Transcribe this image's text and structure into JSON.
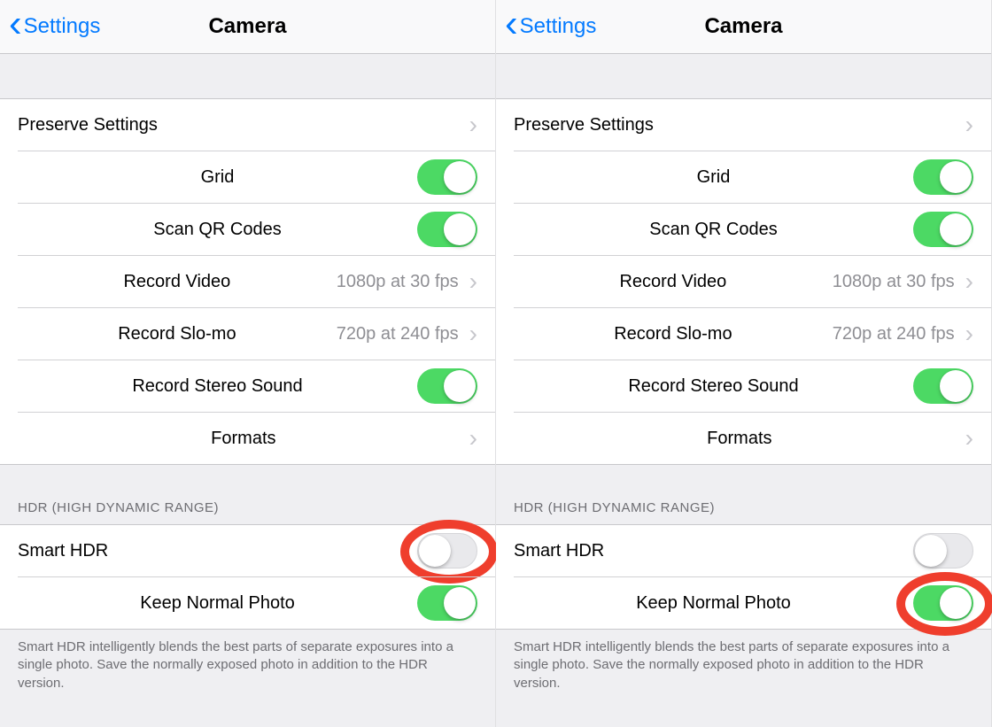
{
  "colors": {
    "tint": "#037aff",
    "toggle_on": "#4cd964",
    "annotation": "#ef3e2d"
  },
  "screens": [
    {
      "nav": {
        "back": "Settings",
        "title": "Camera"
      },
      "group1": [
        {
          "kind": "nav",
          "label": "Preserve Settings"
        },
        {
          "kind": "toggle",
          "label": "Grid",
          "on": true
        },
        {
          "kind": "toggle",
          "label": "Scan QR Codes",
          "on": true
        },
        {
          "kind": "nav",
          "label": "Record Video",
          "value": "1080p at 30 fps"
        },
        {
          "kind": "nav",
          "label": "Record Slo-mo",
          "value": "720p at 240 fps"
        },
        {
          "kind": "toggle",
          "label": "Record Stereo Sound",
          "on": true
        },
        {
          "kind": "nav",
          "label": "Formats"
        }
      ],
      "section_header": "HDR (HIGH DYNAMIC RANGE)",
      "group2": [
        {
          "kind": "toggle",
          "label": "Smart HDR",
          "on": false,
          "annot": true
        },
        {
          "kind": "toggle",
          "label": "Keep Normal Photo",
          "on": true
        }
      ],
      "footer": "Smart HDR intelligently blends the best parts of separate exposures into a single photo. Save the normally exposed photo in addition to the HDR version."
    },
    {
      "nav": {
        "back": "Settings",
        "title": "Camera"
      },
      "group1": [
        {
          "kind": "nav",
          "label": "Preserve Settings"
        },
        {
          "kind": "toggle",
          "label": "Grid",
          "on": true
        },
        {
          "kind": "toggle",
          "label": "Scan QR Codes",
          "on": true
        },
        {
          "kind": "nav",
          "label": "Record Video",
          "value": "1080p at 30 fps"
        },
        {
          "kind": "nav",
          "label": "Record Slo-mo",
          "value": "720p at 240 fps"
        },
        {
          "kind": "toggle",
          "label": "Record Stereo Sound",
          "on": true
        },
        {
          "kind": "nav",
          "label": "Formats"
        }
      ],
      "section_header": "HDR (HIGH DYNAMIC RANGE)",
      "group2": [
        {
          "kind": "toggle",
          "label": "Smart HDR",
          "on": false
        },
        {
          "kind": "toggle",
          "label": "Keep Normal Photo",
          "on": true,
          "annot": true
        }
      ],
      "footer": "Smart HDR intelligently blends the best parts of separate exposures into a single photo. Save the normally exposed photo in addition to the HDR version."
    }
  ]
}
